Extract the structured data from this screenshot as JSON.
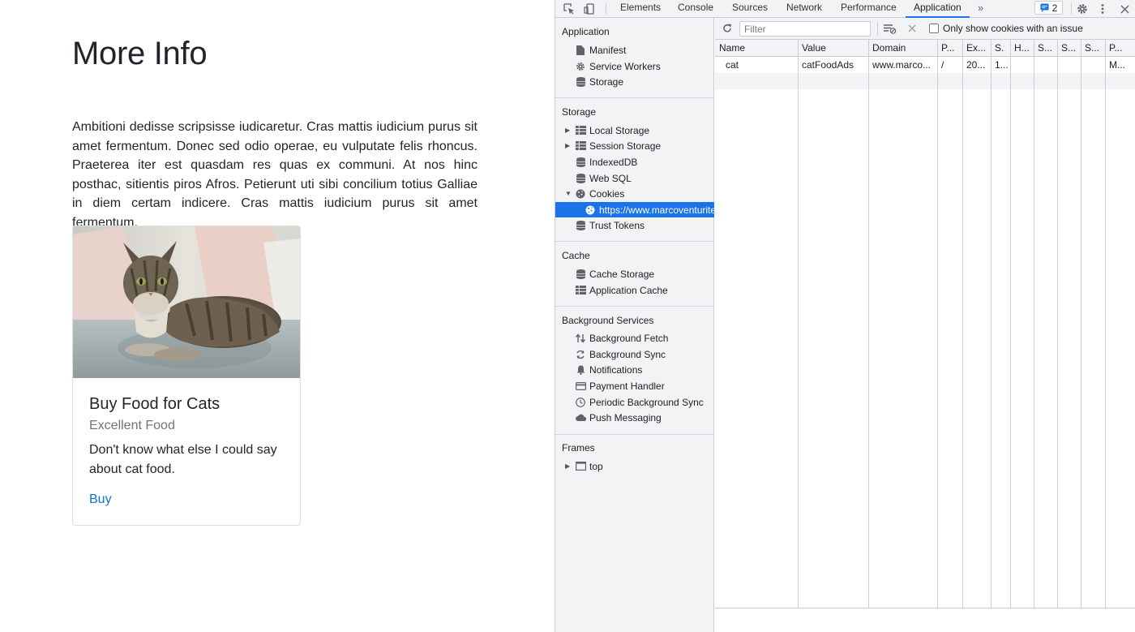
{
  "page": {
    "title": "More Info",
    "lead": "Ambitioni dedisse scripsisse iudicaretur. Cras mattis iudicium purus sit amet fermentum. Donec sed odio operae, eu vulputate felis rhoncus. Praeterea iter est quasdam res quas ex communi. At nos hinc posthac, sitientis piros Afros. Petierunt uti sibi concilium totius Galliae in diem certam indicere. Cras mattis iudicium purus sit amet fermentum.",
    "card": {
      "image": "cat-photo",
      "title": "Buy Food for Cats",
      "subtitle": "Excellent Food",
      "text": "Don't know what else I could say about cat food.",
      "link": "Buy"
    }
  },
  "devtools": {
    "toolbar": {
      "inspect_icon": "inspect-element-icon",
      "device_icon": "device-toolbar-icon",
      "tabs": [
        "Elements",
        "Console",
        "Sources",
        "Network",
        "Performance",
        "Application"
      ],
      "active_tab": "Application",
      "more_tabs": "»",
      "issues_count": "2"
    },
    "sidebar": {
      "sections": [
        {
          "title": "Application",
          "items": [
            {
              "label": "Manifest",
              "icon": "file-icon"
            },
            {
              "label": "Service Workers",
              "icon": "gear-icon"
            },
            {
              "label": "Storage",
              "icon": "database-icon"
            }
          ]
        },
        {
          "title": "Storage",
          "items": [
            {
              "label": "Local Storage",
              "icon": "grid-icon",
              "expandable": true
            },
            {
              "label": "Session Storage",
              "icon": "grid-icon",
              "expandable": true
            },
            {
              "label": "IndexedDB",
              "icon": "database-icon"
            },
            {
              "label": "Web SQL",
              "icon": "database-icon"
            },
            {
              "label": "Cookies",
              "icon": "cookie-icon",
              "expanded": true
            },
            {
              "label": "https://www.marcoventurite",
              "icon": "cookie-icon",
              "selected": true
            },
            {
              "label": "Trust Tokens",
              "icon": "database-icon"
            }
          ]
        },
        {
          "title": "Cache",
          "items": [
            {
              "label": "Cache Storage",
              "icon": "database-icon"
            },
            {
              "label": "Application Cache",
              "icon": "grid-icon"
            }
          ]
        },
        {
          "title": "Background Services",
          "items": [
            {
              "label": "Background Fetch",
              "icon": "up-down-arrows-icon"
            },
            {
              "label": "Background Sync",
              "icon": "sync-icon"
            },
            {
              "label": "Notifications",
              "icon": "bell-icon"
            },
            {
              "label": "Payment Handler",
              "icon": "card-icon"
            },
            {
              "label": "Periodic Background Sync",
              "icon": "clock-icon"
            },
            {
              "label": "Push Messaging",
              "icon": "cloud-icon"
            }
          ]
        },
        {
          "title": "Frames",
          "items": [
            {
              "label": "top",
              "icon": "frame-icon",
              "expandable": true
            }
          ]
        }
      ]
    },
    "filter": {
      "placeholder": "Filter",
      "checkbox_label": "Only show cookies with an issue",
      "checked": false
    },
    "table": {
      "columns": [
        "Name",
        "Value",
        "Domain",
        "P...",
        "Ex...",
        "S.",
        "H...",
        "S...",
        "S...",
        "S...",
        "P..."
      ],
      "rows": [
        [
          "cat",
          "catFoodAds",
          "www.marco...",
          "/",
          "20...",
          "1...",
          "",
          "",
          "",
          "",
          "M..."
        ]
      ]
    }
  }
}
